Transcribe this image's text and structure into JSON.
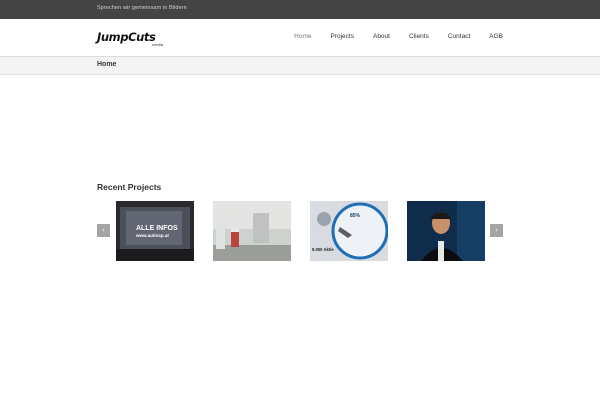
{
  "topbar": {
    "tagline": "Sprechen wir gemeinsam in Bildern"
  },
  "logo": {
    "wordmark": "JumpCuts",
    "sub": "media"
  },
  "nav": {
    "items": [
      "Home",
      "Projects",
      "About",
      "Clients",
      "Contact",
      "AGB"
    ],
    "active": "Home"
  },
  "breadcrumb": {
    "current": "Home"
  },
  "recent_projects": {
    "title": "Recent Projects",
    "prev_icon": "chevron-left-icon",
    "next_icon": "chevron-right-icon",
    "items": [
      {
        "name": "project-thumbnail-1",
        "caption_line1": "ALLE INFOS",
        "caption_line2": "www.autinsp.at"
      },
      {
        "name": "project-thumbnail-2"
      },
      {
        "name": "project-thumbnail-3",
        "badge": "85%",
        "price": "5.000 Aktie"
      },
      {
        "name": "project-thumbnail-4"
      }
    ]
  },
  "colors": {
    "topbar": "#444444",
    "breadcrumb_bg": "#f4f4f4",
    "arrow": "#a5a5a5"
  }
}
